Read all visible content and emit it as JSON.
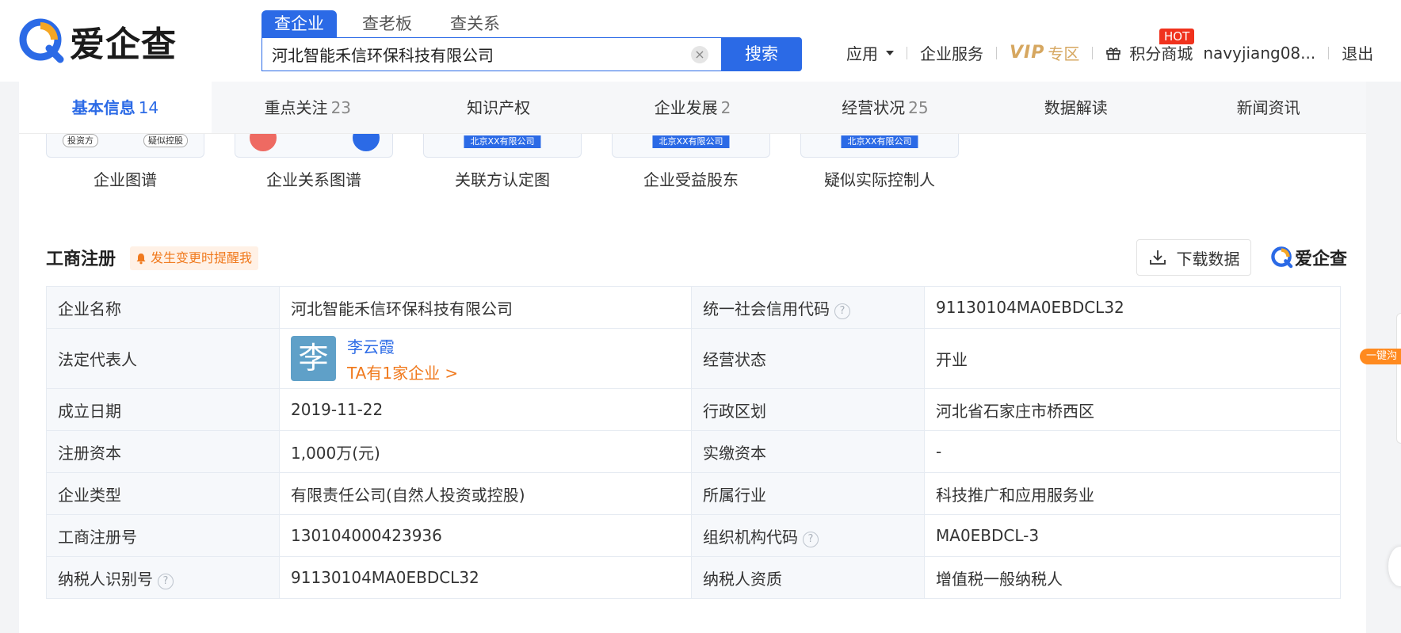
{
  "brand": {
    "name": "爱企查"
  },
  "search": {
    "tabs": [
      "查企业",
      "查老板",
      "查关系"
    ],
    "value": "河北智能禾信环保科技有限公司",
    "button": "搜索"
  },
  "topnav": {
    "apps": "应用",
    "enterprise_service": "企业服务",
    "vip": "VIP",
    "vip_zone": "专区",
    "hot": "HOT",
    "points_mall": "积分商城",
    "user": "navyjiang08...",
    "logout": "退出"
  },
  "tabs": [
    {
      "label": "基本信息",
      "count": "14"
    },
    {
      "label": "重点关注",
      "count": "23"
    },
    {
      "label": "知识产权",
      "count": ""
    },
    {
      "label": "企业发展",
      "count": "2"
    },
    {
      "label": "经营状况",
      "count": "25"
    },
    {
      "label": "数据解读",
      "count": ""
    },
    {
      "label": "新闻资讯",
      "count": ""
    }
  ],
  "graphs": {
    "thumb1_left": "投资方",
    "thumb1_right": "疑似控股",
    "chip": "北京XX有限公司",
    "labels": [
      "企业图谱",
      "企业关系图谱",
      "关联方认定图",
      "企业受益股东",
      "疑似实际控制人"
    ]
  },
  "section": {
    "title": "工商注册",
    "remind": "发生变更时提醒我",
    "download": "下载数据"
  },
  "info": {
    "name_label": "企业名称",
    "name": "河北智能禾信环保科技有限公司",
    "credit_label": "统一社会信用代码",
    "credit": "91130104MA0EBDCL32",
    "rep_label": "法定代表人",
    "rep_avatar": "李",
    "rep_name": "李云霞",
    "rep_link": "TA有1家企业 >",
    "status_label": "经营状态",
    "status": "开业",
    "founded_label": "成立日期",
    "founded": "2019-11-22",
    "region_label": "行政区划",
    "region": "河北省石家庄市桥西区",
    "capital_label": "注册资本",
    "capital": "1,000万(元)",
    "paid_label": "实缴资本",
    "paid": "-",
    "type_label": "企业类型",
    "type": "有限责任公司(自然人投资或控股)",
    "industry_label": "所属行业",
    "industry": "科技推广和应用服务业",
    "regno_label": "工商注册号",
    "regno": "130104000423936",
    "orgcode_label": "组织机构代码",
    "orgcode": "MA0EBDCL-3",
    "taxid_label": "纳税人识别号",
    "taxid": "91130104MA0EBDCL32",
    "taxqual_label": "纳税人资质",
    "taxqual": "增值税一般纳税人"
  },
  "side": {
    "tag": "一键沟"
  },
  "colors": {
    "primary": "#2b6ae6",
    "orange": "#f07a1e",
    "vip": "#d6a760",
    "hot": "#f0321d"
  }
}
